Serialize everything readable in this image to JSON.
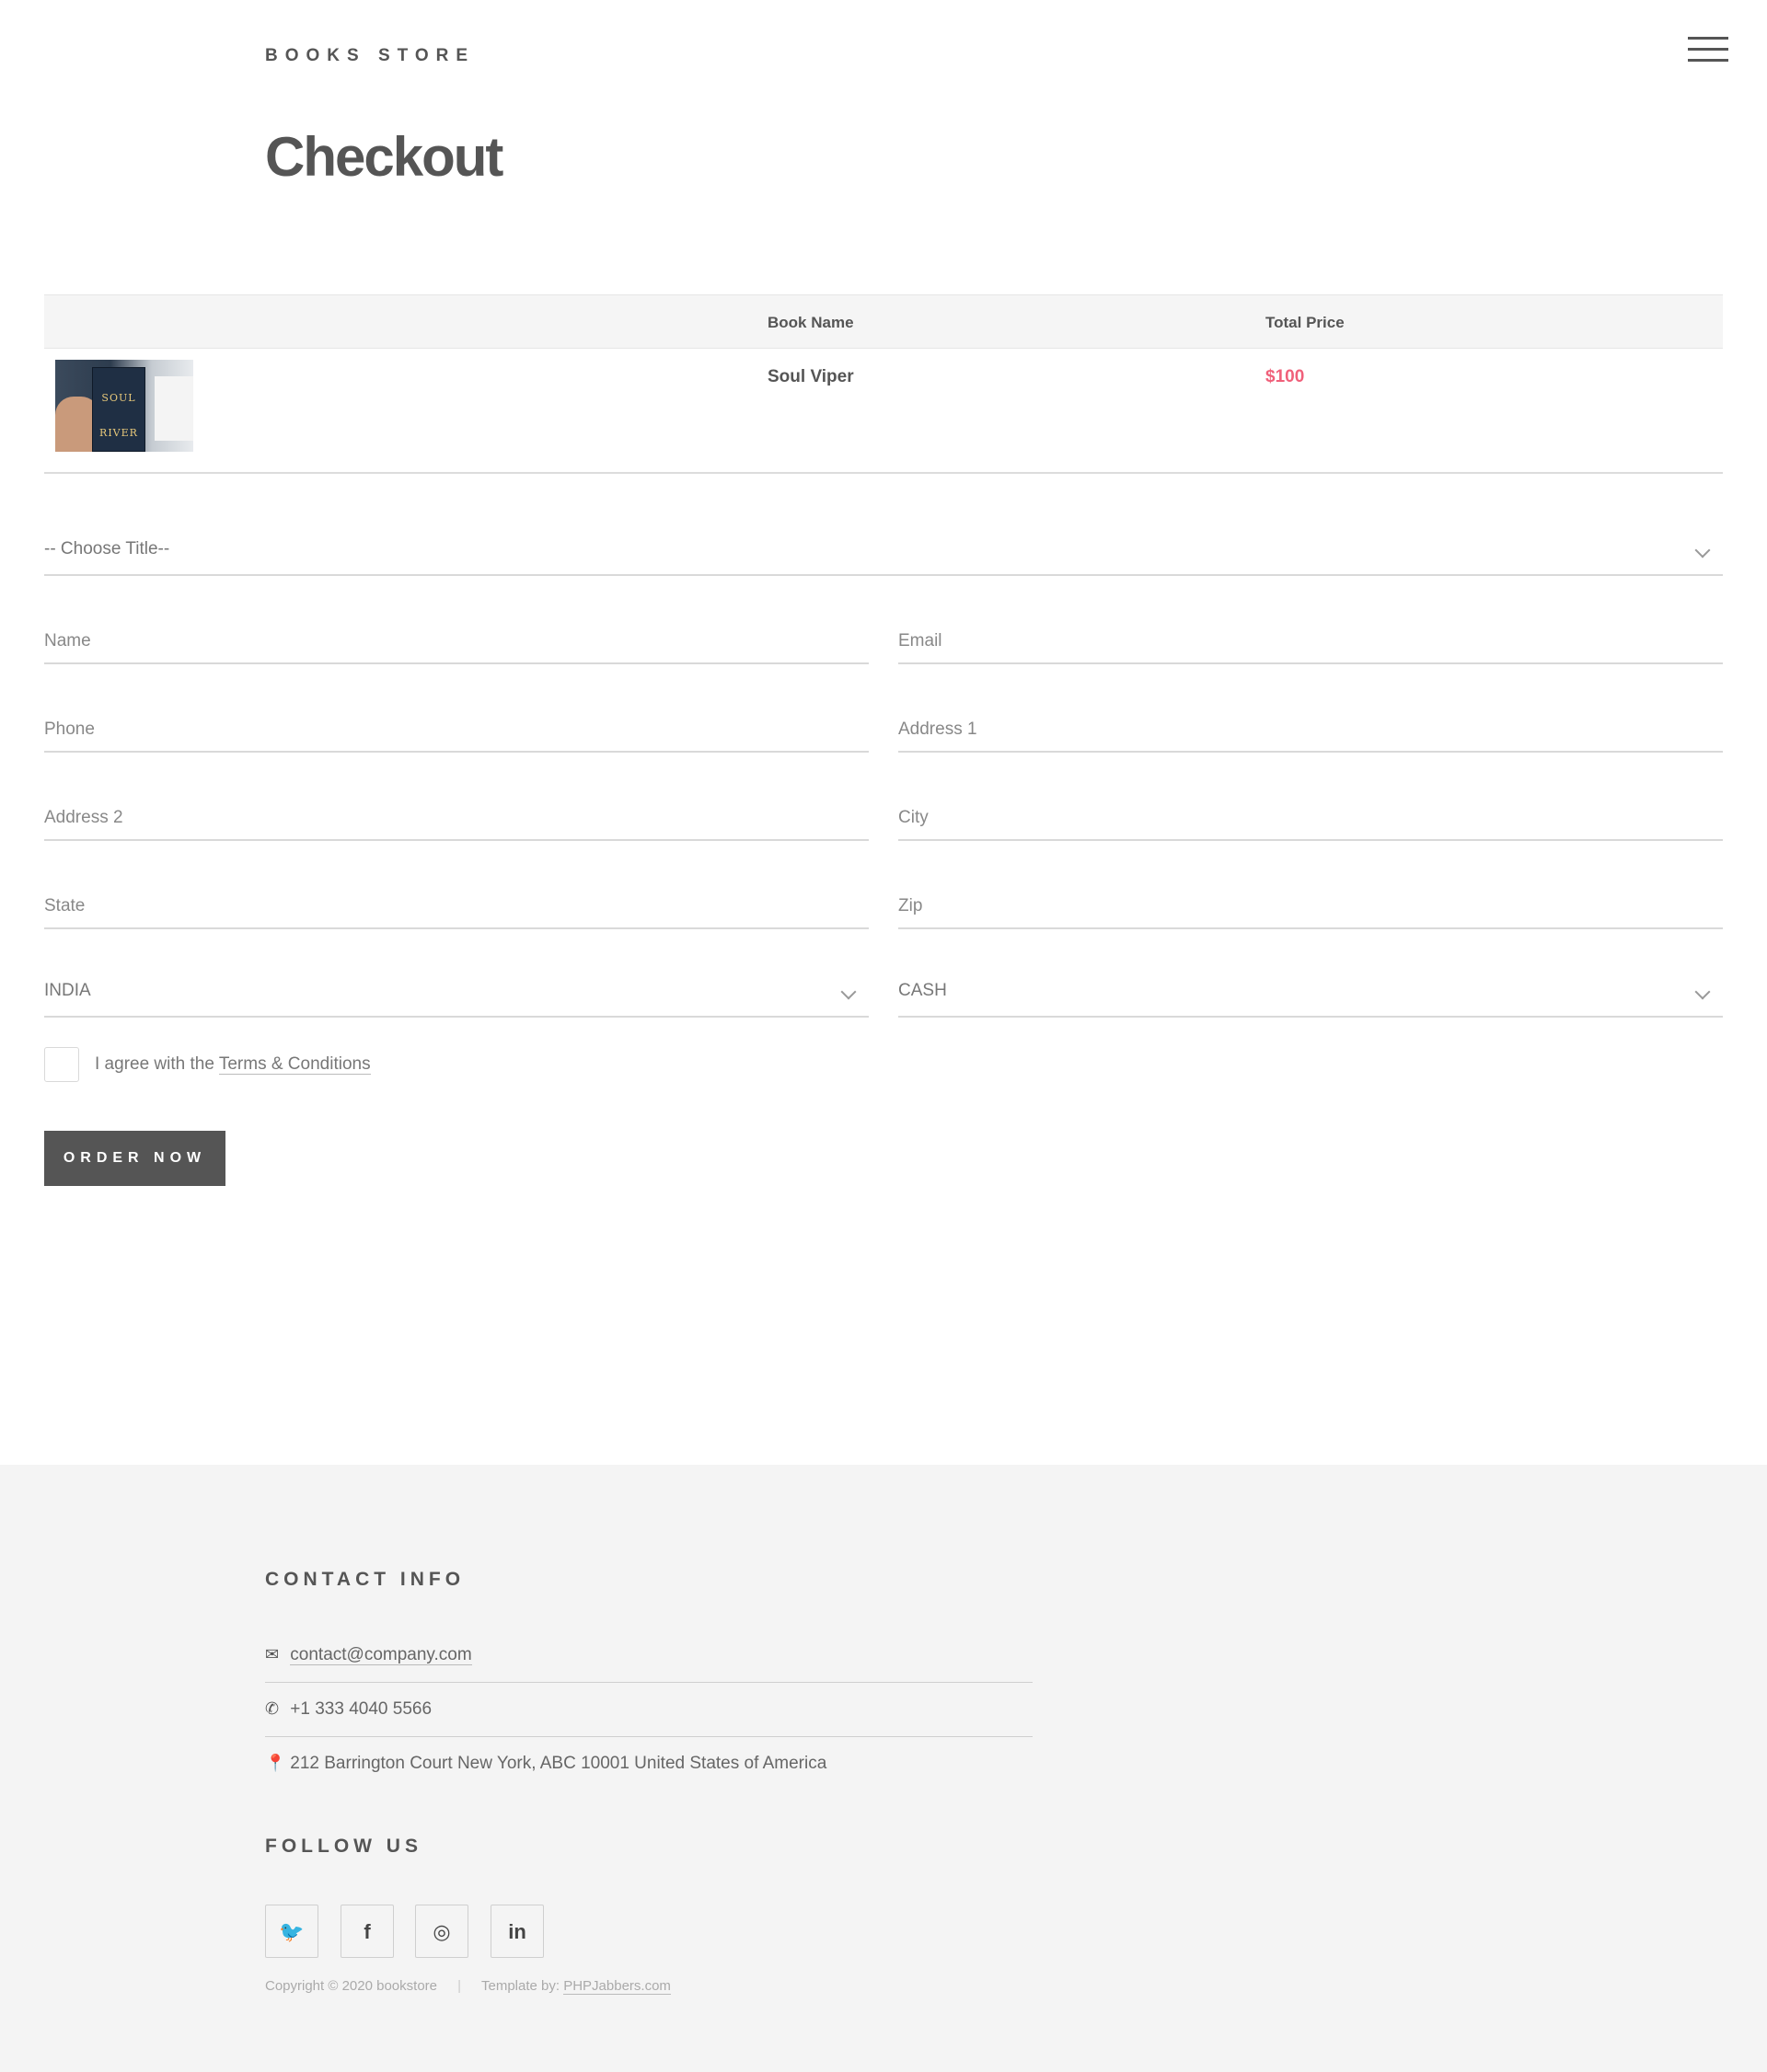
{
  "header": {
    "brand": "BOOKS STORE",
    "menu_icon": "hamburger-menu-icon",
    "page_title": "Checkout"
  },
  "cart": {
    "columns": [
      "",
      "Book Name",
      "Total Price"
    ],
    "rows": [
      {
        "thumbnail_icon": "book-cover-thumbnail",
        "cover_text": [
          "SOUL",
          "RIVER"
        ],
        "book_name": "Soul Viper",
        "total_price": "$100"
      }
    ]
  },
  "form": {
    "title_select": {
      "selected": "-- Choose Title--"
    },
    "name": {
      "placeholder": "Name",
      "value": ""
    },
    "email": {
      "placeholder": "Email",
      "value": ""
    },
    "phone": {
      "placeholder": "Phone",
      "value": ""
    },
    "address1": {
      "placeholder": "Address 1",
      "value": ""
    },
    "address2": {
      "placeholder": "Address 2",
      "value": ""
    },
    "city": {
      "placeholder": "City",
      "value": ""
    },
    "state": {
      "placeholder": "State",
      "value": ""
    },
    "zip": {
      "placeholder": "Zip",
      "value": ""
    },
    "country_select": {
      "selected": "INDIA"
    },
    "payment_select": {
      "selected": "CASH"
    },
    "agree_text": "I agree with the",
    "terms_link": "Terms & Conditions",
    "order_button": "ORDER NOW"
  },
  "footer": {
    "contact_title": "CONTACT INFO",
    "email": "contact@company.com",
    "phone": "+1 333 4040 5566",
    "address": "212 Barrington Court New York, ABC 10001 United States of America",
    "follow_title": "FOLLOW US",
    "social": [
      {
        "icon": "twitter-icon",
        "glyph": "🐦"
      },
      {
        "icon": "facebook-icon",
        "glyph": "f"
      },
      {
        "icon": "instagram-icon",
        "glyph": "◎"
      },
      {
        "icon": "linkedin-icon",
        "glyph": "in"
      }
    ],
    "copyright": "Copyright © 2020 bookstore",
    "template_by": "Template by:",
    "template_link": "PHPJabbers.com"
  },
  "colors": {
    "accent_price": "#f0607a",
    "button_bg": "#555555",
    "footer_bg": "#f4f4f4"
  }
}
